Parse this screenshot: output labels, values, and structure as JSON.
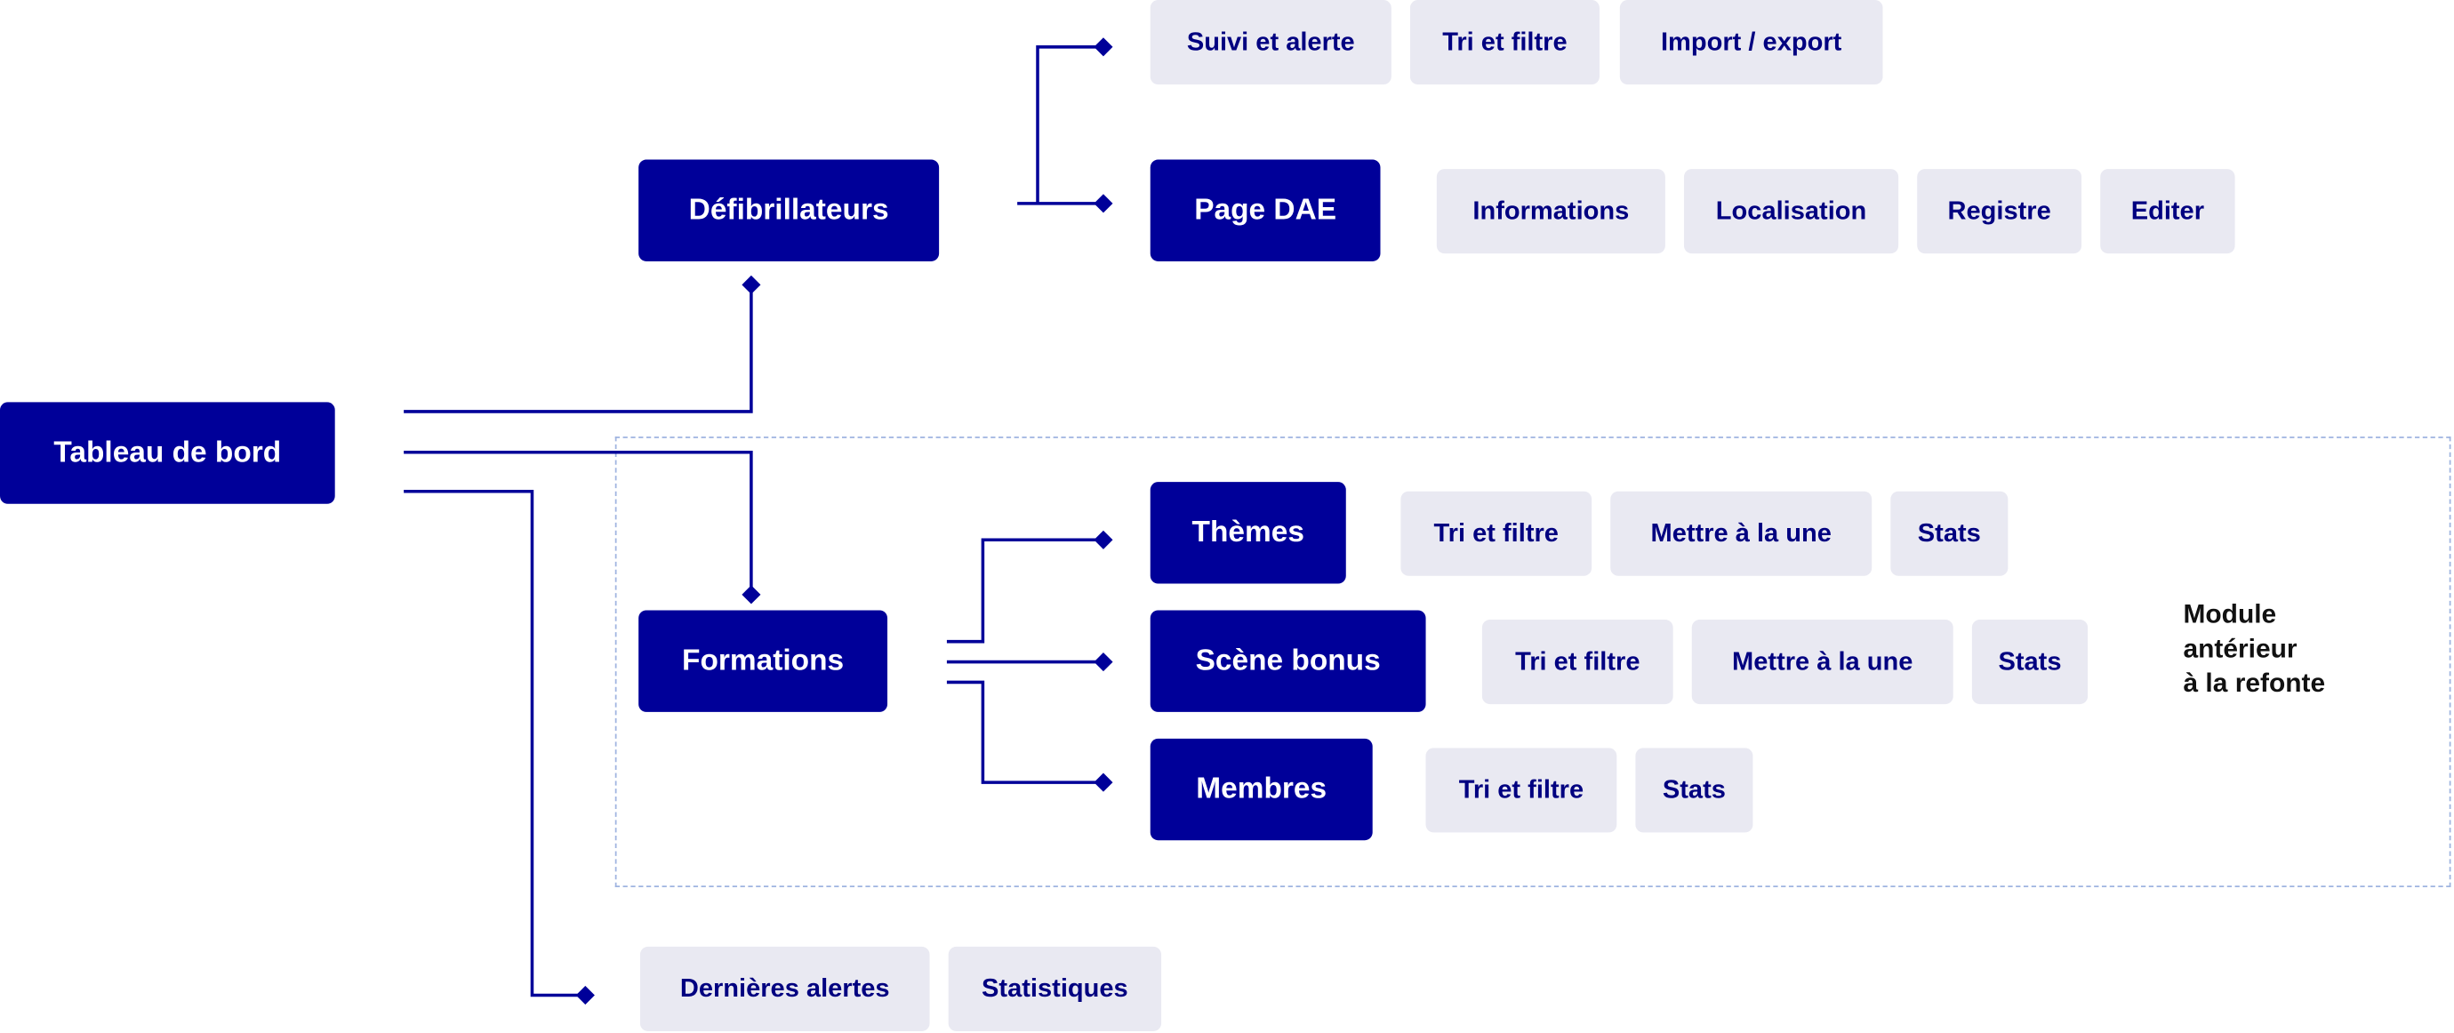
{
  "colors": {
    "primary": "#000099",
    "secondary_bg": "#e9e9f2",
    "secondary_text": "#000080",
    "dashed_border": "#9fb4e0"
  },
  "root": {
    "label": "Tableau de bord"
  },
  "defibrillateurs": {
    "label": "Défibrillateurs",
    "list_actions": [
      "Suivi et alerte",
      "Tri et filtre",
      "Import / export"
    ],
    "page_dae": {
      "label": "Page DAE",
      "actions": [
        "Informations",
        "Localisation",
        "Registre",
        "Editer"
      ]
    }
  },
  "formations": {
    "label": "Formations",
    "themes": {
      "label": "Thèmes",
      "actions": [
        "Tri et filtre",
        "Mettre à la une",
        "Stats"
      ]
    },
    "scene_bonus": {
      "label": "Scène bonus",
      "actions": [
        "Tri et filtre",
        "Mettre à la une",
        "Stats"
      ]
    },
    "membres": {
      "label": "Membres",
      "actions": [
        "Tri et filtre",
        "Stats"
      ]
    }
  },
  "dashboard_items": [
    "Dernières alertes",
    "Statistiques"
  ],
  "legacy_note": "Module\nantérieur\nà la refonte"
}
